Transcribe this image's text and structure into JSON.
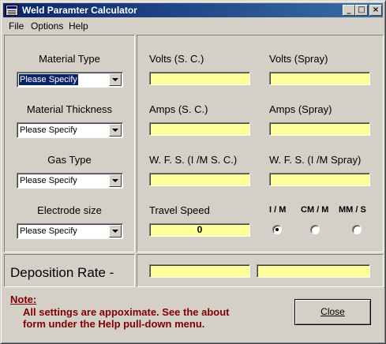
{
  "window": {
    "title": "Weld Paramter Calculator"
  },
  "menu": [
    "File",
    "Options",
    "Help"
  ],
  "left_panel": {
    "groups": [
      {
        "label": "Material Type",
        "value": "Please Specify",
        "highlighted": true
      },
      {
        "label": "Material Thickness",
        "value": "Please Specify",
        "highlighted": false
      },
      {
        "label": "Gas Type",
        "value": "Please Specify",
        "highlighted": false
      },
      {
        "label": "Electrode size",
        "value": "Please Specify",
        "highlighted": false
      }
    ]
  },
  "right_panel": {
    "fields": {
      "volts_sc": {
        "label": "Volts (S. C.)",
        "value": ""
      },
      "volts_spray": {
        "label": "Volts (Spray)",
        "value": ""
      },
      "amps_sc": {
        "label": "Amps (S. C.)",
        "value": ""
      },
      "amps_spray": {
        "label": "Amps (Spray)",
        "value": ""
      },
      "wfs_sc": {
        "label": "W. F. S. (I /M S. C.)",
        "value": ""
      },
      "wfs_spray": {
        "label": "W. F. S. (I /M Spray)",
        "value": ""
      },
      "travel_speed": {
        "label": "Travel Speed",
        "value": "0"
      }
    },
    "units": {
      "options": [
        "I / M",
        "CM / M",
        "MM / S"
      ],
      "selected": "I / M"
    }
  },
  "deposition": {
    "label": "Deposition Rate -",
    "value_1": "",
    "value_2": ""
  },
  "note": {
    "title": "Note:",
    "line1": "All settings are appoximate. See the about",
    "line2": "form under the Help pull-down menu."
  },
  "buttons": {
    "close_label": "Close"
  },
  "colors": {
    "field_bg": "#ffff99",
    "note_text": "#800000",
    "title_bar": "#0a246a"
  }
}
